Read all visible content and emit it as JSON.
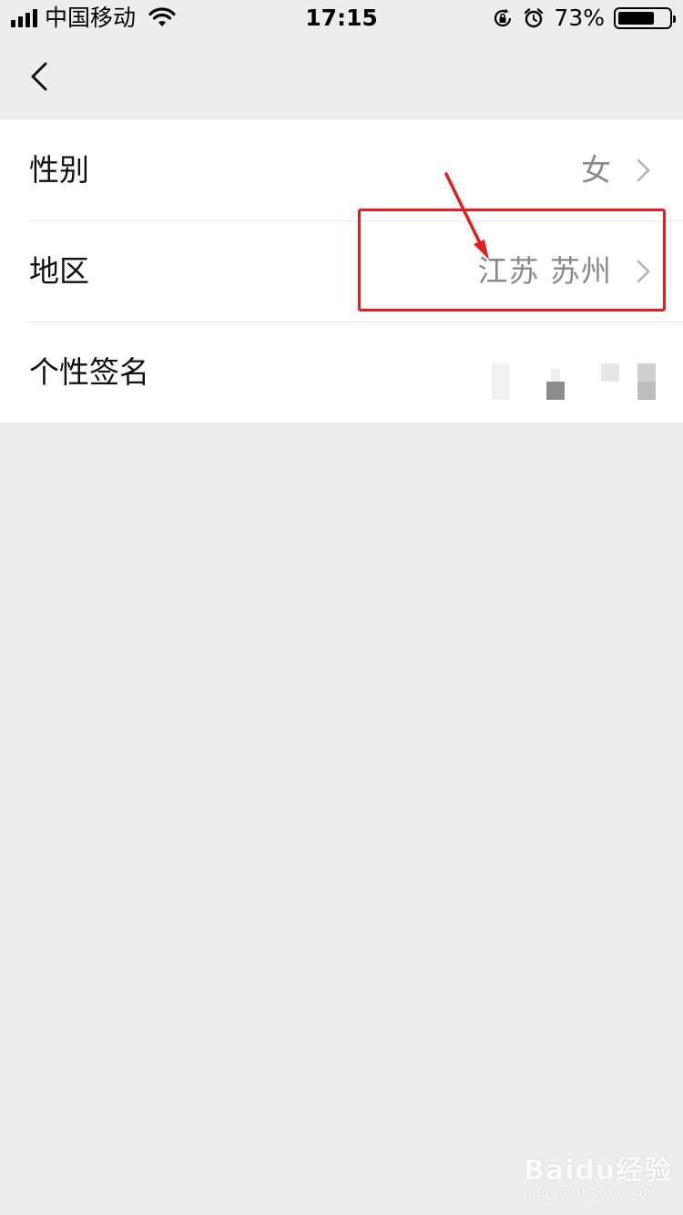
{
  "status_bar": {
    "carrier": "中国移动",
    "time": "17:15",
    "battery_percent": "73%",
    "battery_level": 0.73,
    "icons": [
      "signal-icon",
      "wifi-icon",
      "rotation-lock-icon",
      "alarm-icon",
      "battery-icon"
    ]
  },
  "nav": {
    "back_icon": "chevron-left-icon"
  },
  "settings": {
    "items": [
      {
        "label": "性别",
        "value": "女"
      },
      {
        "label": "地区",
        "value": "江苏 苏州"
      },
      {
        "label": "个性签名",
        "value": ""
      }
    ]
  },
  "annotation": {
    "color": "#e02020"
  },
  "watermark": {
    "main": "Baidu经验",
    "sub": "jingyan.baidu.com"
  }
}
